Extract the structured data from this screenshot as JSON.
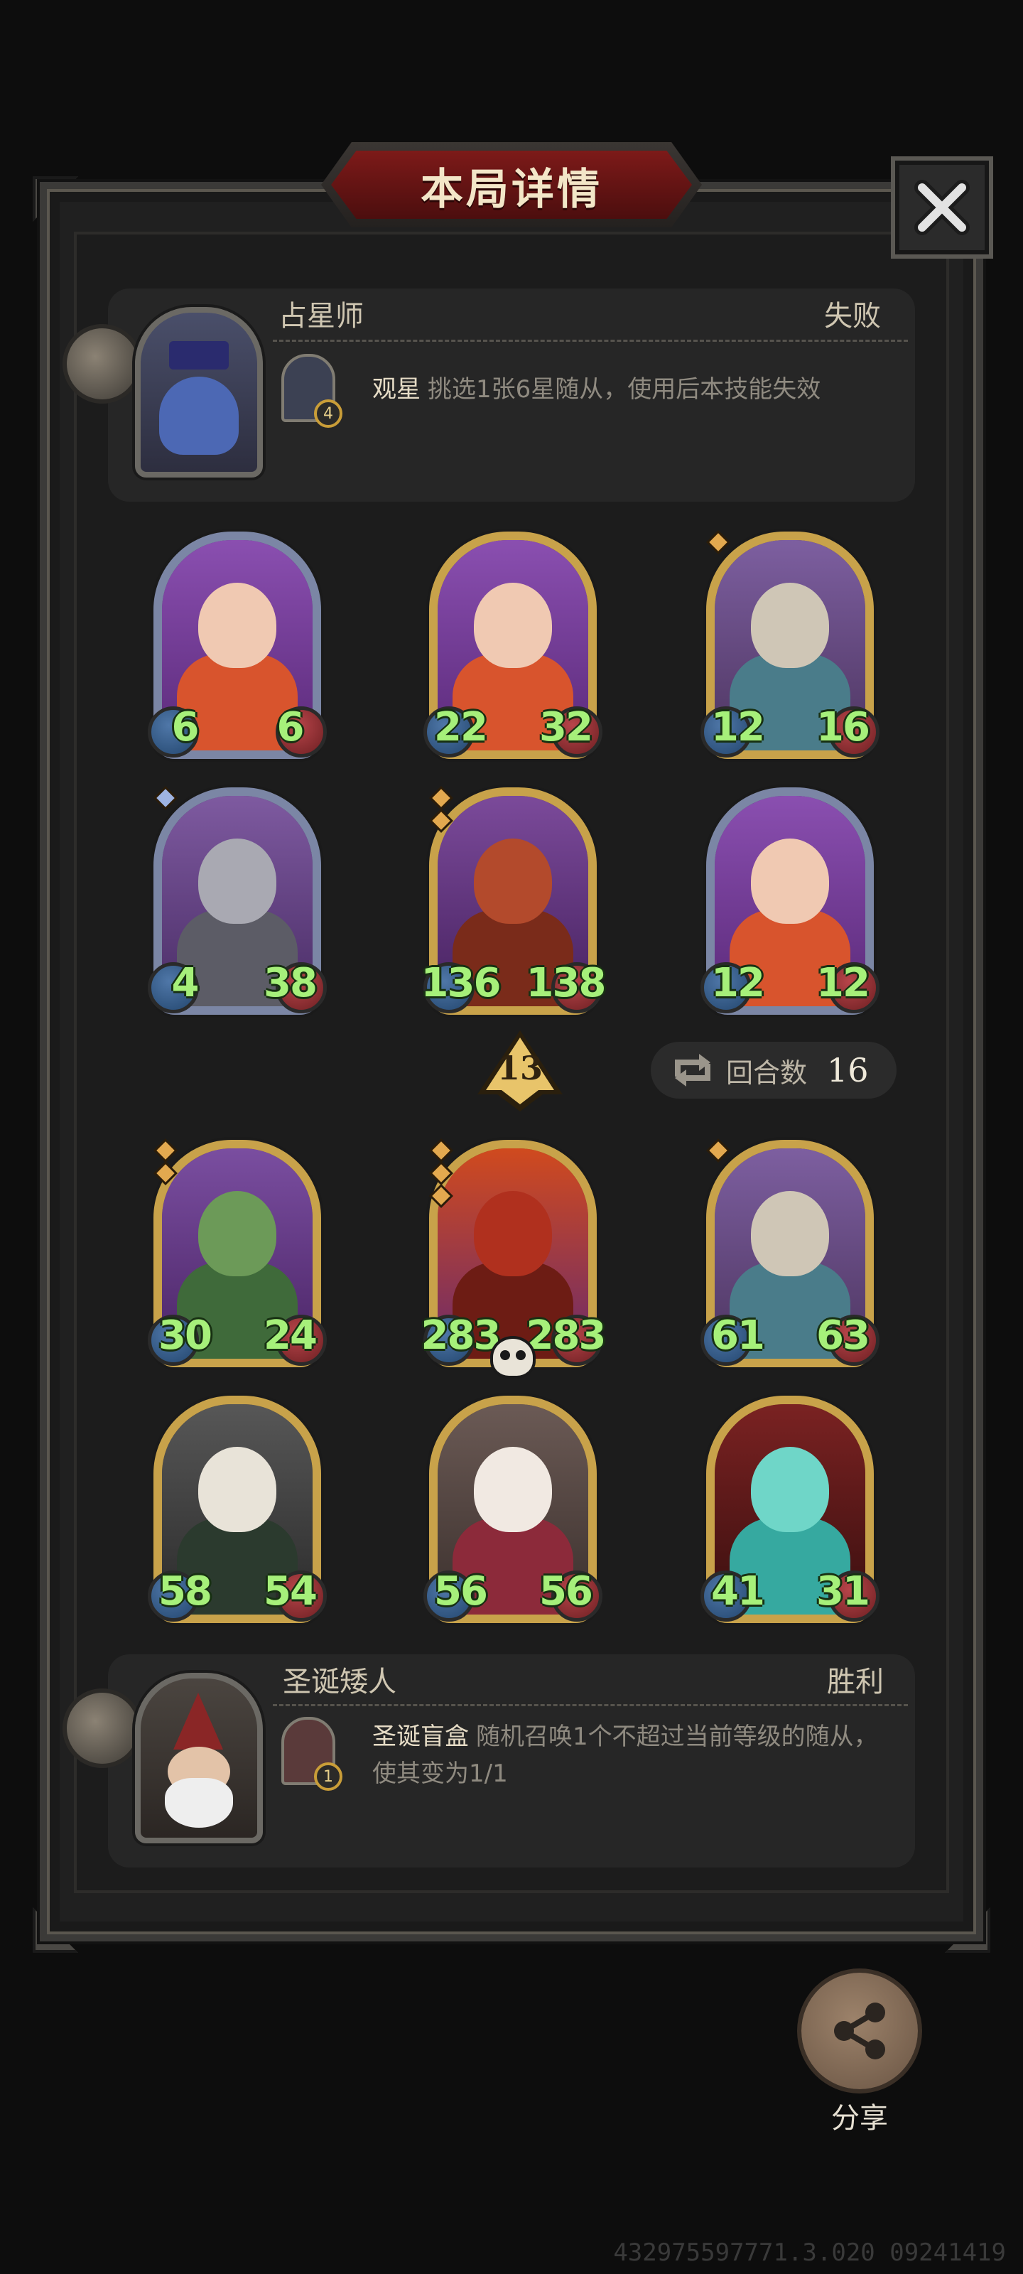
{
  "header": {
    "title": "本局详情"
  },
  "opponent": {
    "name": "占星师",
    "result": "失败",
    "skill": {
      "name": "观星",
      "description": "挑选1张6星随从，使用后本技能失效",
      "level": "4"
    }
  },
  "opponent_board": [
    {
      "attack": "6",
      "health": "6",
      "frame": "silver",
      "stars": 0,
      "theme": "red-hair"
    },
    {
      "attack": "22",
      "health": "32",
      "frame": "gold",
      "stars": 0,
      "theme": "red-hair"
    },
    {
      "attack": "12",
      "health": "16",
      "frame": "gold",
      "stars": 1,
      "theme": "beast"
    },
    {
      "attack": "4",
      "health": "38",
      "frame": "silver",
      "stars": 1,
      "star_color": "blue",
      "theme": "dragon-grey"
    },
    {
      "attack": "136",
      "health": "138",
      "frame": "gold",
      "stars": 2,
      "theme": "dragon-red"
    },
    {
      "attack": "12",
      "health": "12",
      "frame": "silver",
      "stars": 0,
      "theme": "red-hair"
    }
  ],
  "tier_badge": {
    "value": "13"
  },
  "rounds": {
    "label": "回合数",
    "value": "16"
  },
  "player_board": [
    {
      "attack": "30",
      "health": "24",
      "frame": "gold",
      "stars": 2,
      "theme": "dragon-green"
    },
    {
      "attack": "283",
      "health": "283",
      "frame": "gold",
      "stars": 3,
      "theme": "demon",
      "skull": true
    },
    {
      "attack": "61",
      "health": "63",
      "frame": "gold",
      "stars": 1,
      "theme": "beast"
    },
    {
      "attack": "58",
      "health": "54",
      "frame": "gold",
      "stars": 0,
      "theme": "reaper"
    },
    {
      "attack": "56",
      "health": "56",
      "frame": "gold",
      "stars": 0,
      "theme": "clown"
    },
    {
      "attack": "41",
      "health": "31",
      "frame": "gold",
      "stars": 0,
      "theme": "ghost"
    }
  ],
  "player": {
    "name": "圣诞矮人",
    "result": "胜利",
    "skill": {
      "name": "圣诞盲盒",
      "description": "随机召唤1个不超过当前等级的随从，使其变为1/1",
      "level": "1"
    }
  },
  "share": {
    "label": "分享"
  },
  "footer": {
    "id_text": "432975597771.3.020 09241419"
  },
  "colors": {
    "stat_text": "#a6f07a",
    "gold_frame": "#c8a24a",
    "silver_frame": "#7b86a5",
    "title_red": "#7d1a19"
  }
}
